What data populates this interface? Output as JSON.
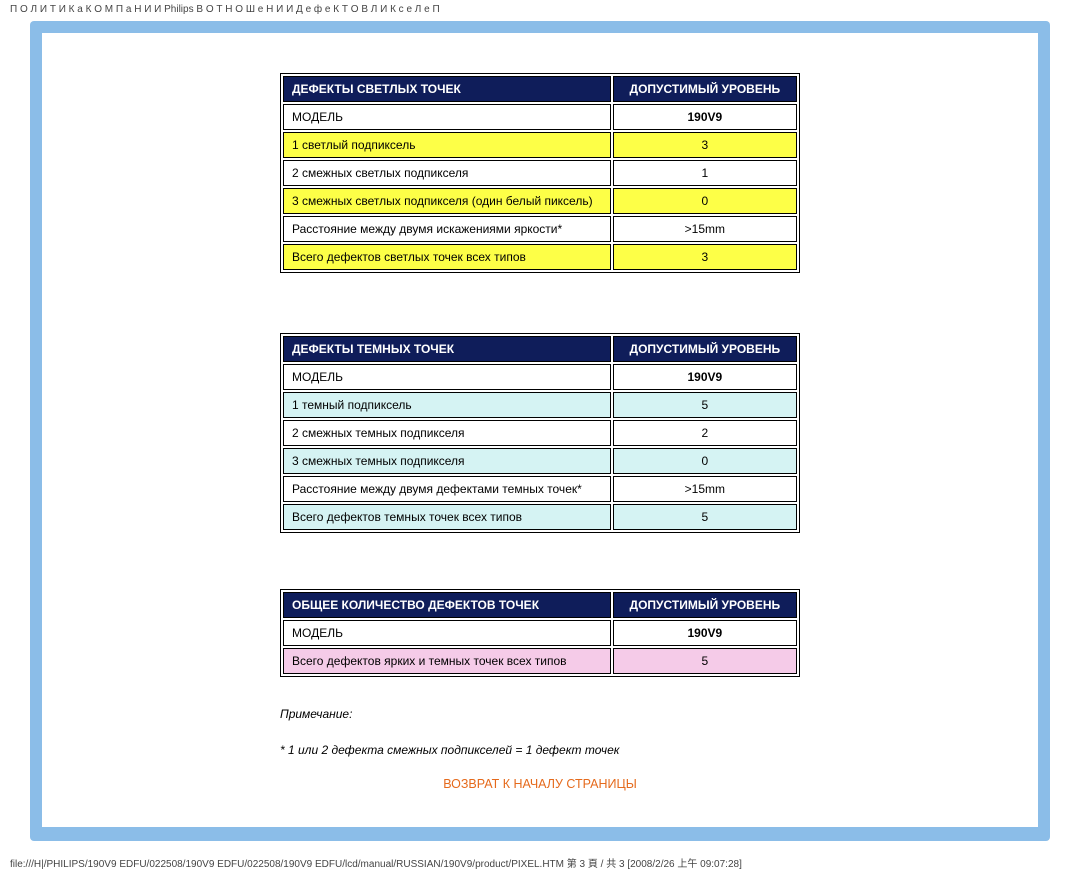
{
  "top_line": "П О Л И Т И К а  К О М П а Н И И  Philips  В  О Т Н О Ш е Н И И  Д е ф е К Т О В  Л И К с е Л е П",
  "footer_line": "file:///H|/PHILIPS/190V9 EDFU/022508/190V9 EDFU/022508/190V9 EDFU/lcd/manual/RUSSIAN/190V9/product/PIXEL.HTM 第 3 頁 / 共 3 [2008/2/26 上午 09:07:28]",
  "tables": {
    "bright": {
      "header_left": "ДЕФЕКТЫ СВЕТЛЫХ ТОЧЕК",
      "header_right": "ДОПУСТИМЫЙ УРОВЕНЬ",
      "model_label": "МОДЕЛЬ",
      "model_value": "190V9",
      "row1": {
        "label": "1 светлый подпиксель",
        "value": "3"
      },
      "row2": {
        "label": "2 смежных светлых подпикселя",
        "value": "1"
      },
      "row3": {
        "label": "3 смежных светлых подпикселя (один белый пиксель)",
        "value": "0"
      },
      "row4": {
        "label": "Расстояние между двумя искажениями яркости*",
        "value": ">15mm"
      },
      "row5": {
        "label": "Всего дефектов светлых точек всех типов",
        "value": "3"
      }
    },
    "dark": {
      "header_left": "ДЕФЕКТЫ ТЕМНЫХ ТОЧЕК",
      "header_right": "ДОПУСТИМЫЙ УРОВЕНЬ",
      "model_label": "МОДЕЛЬ",
      "model_value": "190V9",
      "row1": {
        "label": "1 темный подпиксель",
        "value": "5"
      },
      "row2": {
        "label": "2 смежных темных подпикселя",
        "value": "2"
      },
      "row3": {
        "label": "3 смежных темных подпикселя",
        "value": "0"
      },
      "row4": {
        "label": "Расстояние между двумя дефектами темных точек*",
        "value": ">15mm"
      },
      "row5": {
        "label": "Всего дефектов темных точек всех типов",
        "value": "5"
      }
    },
    "total": {
      "header_left": "ОБЩЕЕ КОЛИЧЕСТВО ДЕФЕКТОВ ТОЧЕК",
      "header_right": "ДОПУСТИМЫЙ УРОВЕНЬ",
      "model_label": "МОДЕЛЬ",
      "model_value": "190V9",
      "row1": {
        "label": "Всего дефектов ярких и темных точек всех типов",
        "value": "5"
      }
    }
  },
  "notes": {
    "line1": "Примечание:",
    "line2": "* 1 или 2 дефекта смежных подпикселей = 1 дефект точек"
  },
  "return_link": "ВОЗВРАТ К НАЧАЛУ СТРАНИЦЫ"
}
